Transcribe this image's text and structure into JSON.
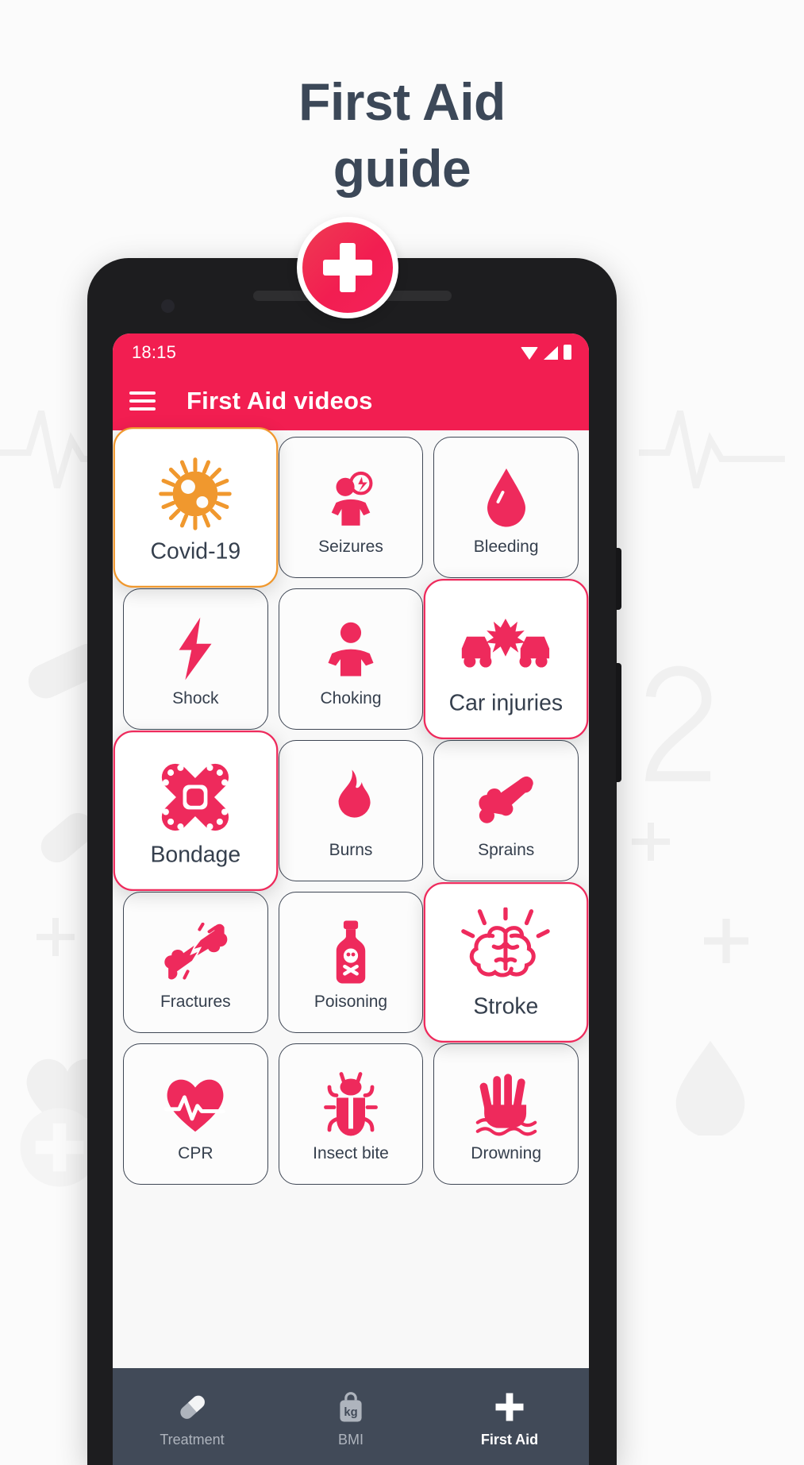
{
  "hero": {
    "line1": "First Aid",
    "line2": "guide",
    "badge_icon": "medical-cross-icon",
    "title_color": "#3c4858"
  },
  "phone": {
    "statusbar": {
      "time": "18:15",
      "icons": [
        "wifi-icon",
        "signal-icon",
        "battery-icon"
      ],
      "background_color": "#f21e51"
    },
    "appbar": {
      "menu_icon": "hamburger-menu-icon",
      "title": "First Aid videos",
      "background_color": "#f21e51"
    },
    "grid": {
      "cards": [
        {
          "label": "Covid-19",
          "icon": "virus-icon",
          "highlight": "orange",
          "accent": "#f0982e"
        },
        {
          "label": "Seizures",
          "icon": "seizure-icon",
          "highlight": "none",
          "accent": "#ee2a5c"
        },
        {
          "label": "Bleeding",
          "icon": "blood-drop-icon",
          "highlight": "none",
          "accent": "#ee2a5c"
        },
        {
          "label": "Shock",
          "icon": "lightning-icon",
          "highlight": "none",
          "accent": "#ee2a5c"
        },
        {
          "label": "Choking",
          "icon": "choking-icon",
          "highlight": "none",
          "accent": "#ee2a5c"
        },
        {
          "label": "Car injuries",
          "icon": "car-crash-icon",
          "highlight": "red",
          "accent": "#ee2a5c"
        },
        {
          "label": "Bondage",
          "icon": "bandage-cross-icon",
          "highlight": "red",
          "accent": "#ee2a5c"
        },
        {
          "label": "Burns",
          "icon": "flame-icon",
          "highlight": "none",
          "accent": "#ee2a5c"
        },
        {
          "label": "Sprains",
          "icon": "joint-bone-icon",
          "highlight": "none",
          "accent": "#ee2a5c"
        },
        {
          "label": "Fractures",
          "icon": "broken-bone-icon",
          "highlight": "none",
          "accent": "#ee2a5c"
        },
        {
          "label": "Poisoning",
          "icon": "poison-bottle-icon",
          "highlight": "none",
          "accent": "#ee2a5c"
        },
        {
          "label": "Stroke",
          "icon": "brain-icon",
          "highlight": "red",
          "accent": "#ee2a5c"
        },
        {
          "label": "CPR",
          "icon": "heart-pulse-icon",
          "highlight": "none",
          "accent": "#ee2a5c"
        },
        {
          "label": "Insect bite",
          "icon": "bug-icon",
          "highlight": "none",
          "accent": "#ee2a5c"
        },
        {
          "label": "Drowning",
          "icon": "drowning-hand-icon",
          "highlight": "none",
          "accent": "#ee2a5c"
        }
      ]
    },
    "bottomnav": {
      "background_color": "#414a58",
      "items": [
        {
          "label": "Treatment",
          "icon": "pill-icon",
          "active": false
        },
        {
          "label": "BMI",
          "icon": "kg-bag-icon",
          "active": false
        },
        {
          "label": "First Aid",
          "icon": "plus-icon",
          "active": true
        }
      ]
    }
  }
}
